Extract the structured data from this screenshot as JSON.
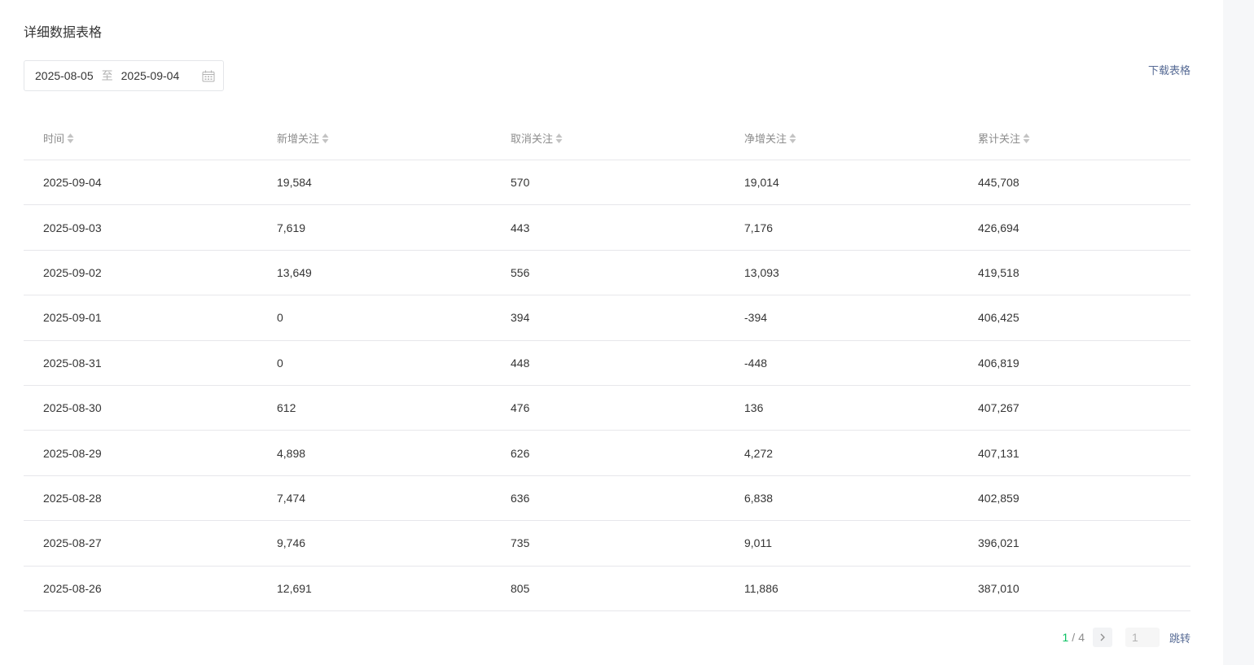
{
  "title": "详细数据表格",
  "date_range": {
    "start": "2025-08-05",
    "separator": "至",
    "end": "2025-09-04",
    "icon": "calendar-icon"
  },
  "download_label": "下载表格",
  "columns": [
    "时间",
    "新增关注",
    "取消关注",
    "净增关注",
    "累计关注"
  ],
  "rows": [
    [
      "2025-09-04",
      "19,584",
      "570",
      "19,014",
      "445,708"
    ],
    [
      "2025-09-03",
      "7,619",
      "443",
      "7,176",
      "426,694"
    ],
    [
      "2025-09-02",
      "13,649",
      "556",
      "13,093",
      "419,518"
    ],
    [
      "2025-09-01",
      "0",
      "394",
      "-394",
      "406,425"
    ],
    [
      "2025-08-31",
      "0",
      "448",
      "-448",
      "406,819"
    ],
    [
      "2025-08-30",
      "612",
      "476",
      "136",
      "407,267"
    ],
    [
      "2025-08-29",
      "4,898",
      "626",
      "4,272",
      "407,131"
    ],
    [
      "2025-08-28",
      "7,474",
      "636",
      "6,838",
      "402,859"
    ],
    [
      "2025-08-27",
      "9,746",
      "735",
      "9,011",
      "396,021"
    ],
    [
      "2025-08-26",
      "12,691",
      "805",
      "11,886",
      "387,010"
    ]
  ],
  "pagination": {
    "current": "1",
    "divider": "/",
    "total": "4",
    "input_value": "1",
    "jump_label": "跳转"
  },
  "colors": {
    "accent": "#07c160",
    "link": "#576b95"
  }
}
